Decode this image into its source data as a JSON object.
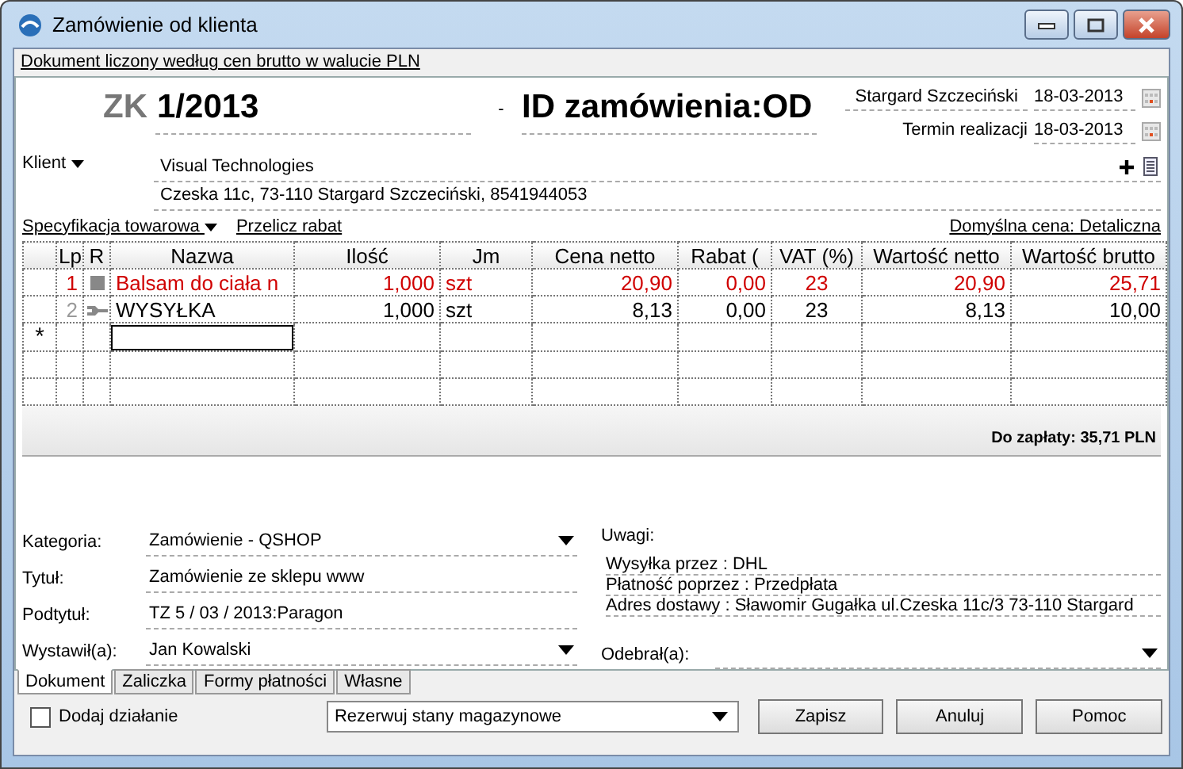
{
  "window": {
    "title": "Zamówienie od klienta"
  },
  "info_link": "Dokument liczony według cen brutto w walucie PLN",
  "header": {
    "doc_type": "ZK",
    "number": "1/2013",
    "separator": "-",
    "order_id": "ID zamówienia:OD",
    "place": "Stargard Szczeciński",
    "issue_date": "18-03-2013",
    "due_label": "Termin realizacji",
    "due_date": "18-03-2013"
  },
  "client": {
    "label": "Klient",
    "name": "Visual Technologies",
    "address": "Czeska 11c, 73-110 Stargard Szczeciński, 8541944053"
  },
  "grid_toolbar": {
    "spec": "Specyfikacja towarowa",
    "recalc": "Przelicz rabat",
    "default_price": "Domyślna cena: Detaliczna"
  },
  "table": {
    "columns": [
      "Lp",
      "R",
      "Nazwa",
      "Ilość",
      "Jm",
      "Cena netto",
      "Rabat (",
      "VAT (%)",
      "Wartość netto",
      "Wartość brutto"
    ],
    "rows": [
      {
        "lp": "1",
        "kind": "product",
        "alert": true,
        "name": "Balsam do ciała n",
        "qty": "1,000",
        "unit": "szt",
        "price": "20,90",
        "discount": "0,00",
        "vat": "23",
        "net": "20,90",
        "gross": "25,71"
      },
      {
        "lp": "2",
        "kind": "service",
        "alert": false,
        "name": "WYSYŁKA",
        "qty": "1,000",
        "unit": "szt",
        "price": "8,13",
        "discount": "0,00",
        "vat": "23",
        "net": "8,13",
        "gross": "10,00"
      }
    ],
    "new_row_marker": "*"
  },
  "total": "Do zapłaty: 35,71 PLN",
  "fields": [
    {
      "label": "Kategoria:",
      "value": "Zamówienie - QSHOP",
      "kind": "dropdown"
    },
    {
      "label": "Tytuł:",
      "value": "Zamówienie ze sklepu www",
      "kind": "text"
    },
    {
      "label": "Podtytuł:",
      "value": "TZ 5 / 03 / 2013:Paragon",
      "kind": "text"
    },
    {
      "label": "Wystawił(a):",
      "value": "Jan Kowalski",
      "kind": "dropdown"
    }
  ],
  "notes": {
    "label": "Uwagi:",
    "lines": [
      "Wysyłka przez : DHL",
      "Płatność poprzez : Przedpłata",
      "Adres dostawy : Sławomir Gugałka ul.Czeska 11c/3 73-110 Stargard"
    ]
  },
  "received": {
    "label": "Odebrał(a):"
  },
  "tabs": [
    {
      "label": "Dokument",
      "selected": true
    },
    {
      "label": "Zaliczka",
      "selected": false
    },
    {
      "label": "Formy płatności",
      "selected": false
    },
    {
      "label": "Własne",
      "selected": false
    }
  ],
  "footer": {
    "checkbox": {
      "label": "Dodaj działanie",
      "checked": false
    },
    "action": "Rezerwuj stany magazynowe",
    "buttons": [
      "Zapisz",
      "Anuluj",
      "Pomoc"
    ]
  }
}
